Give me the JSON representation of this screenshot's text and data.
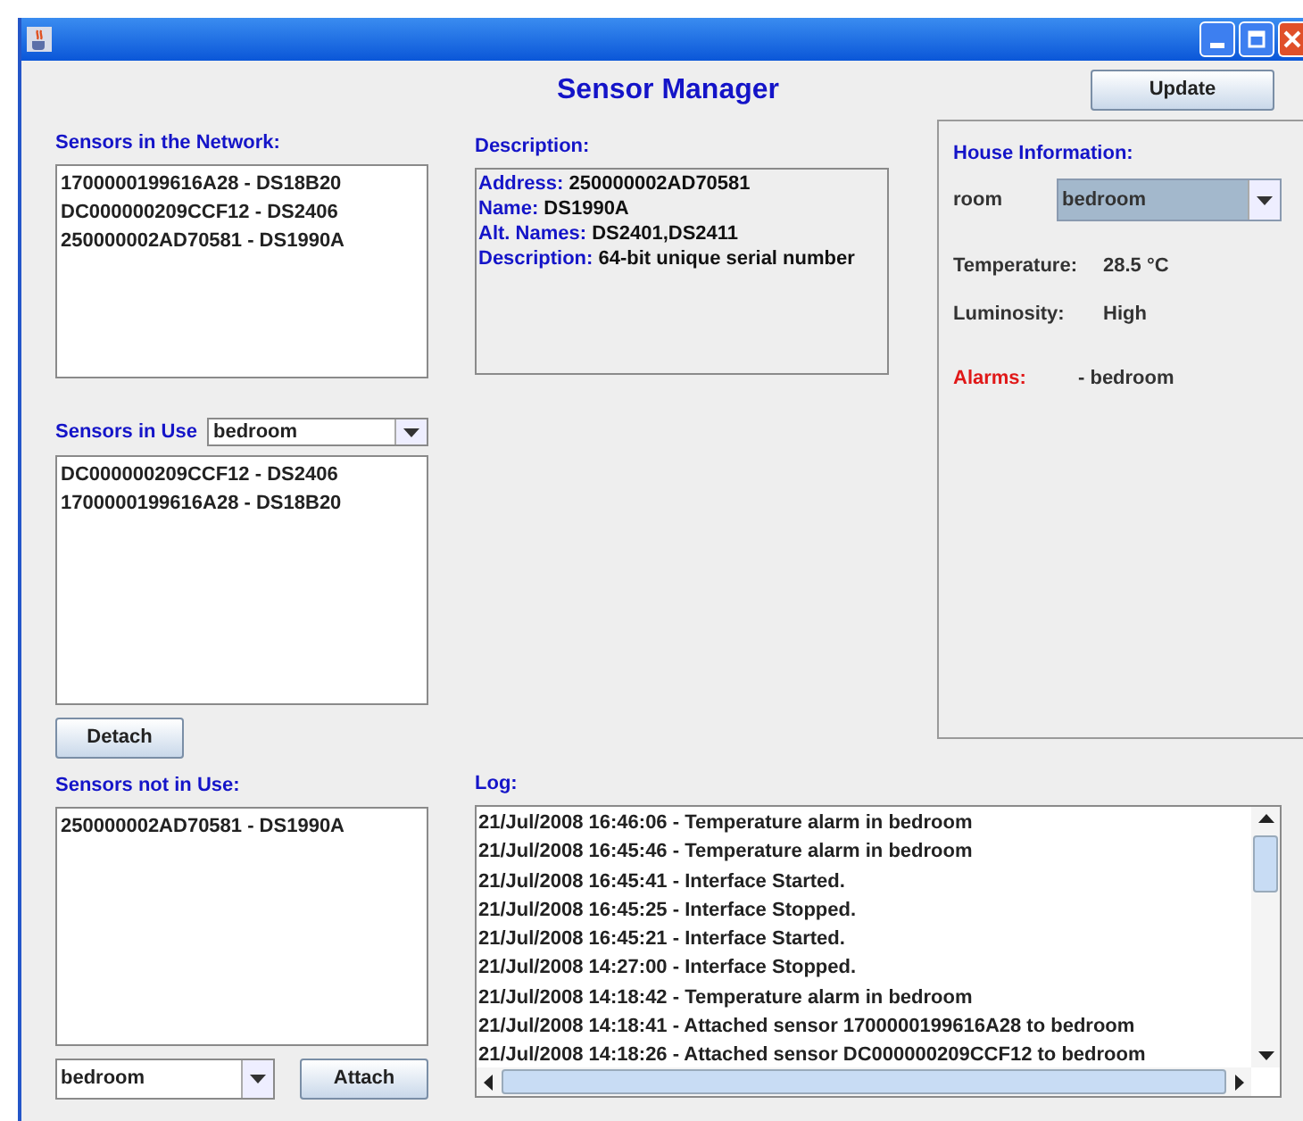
{
  "title": "Sensor Manager",
  "update_button": "Update",
  "network": {
    "label": "Sensors in the Network:",
    "items": [
      "1700000199616A28 - DS18B20",
      "DC000000209CCF12 - DS2406",
      "250000002AD70581 - DS1990A"
    ]
  },
  "in_use": {
    "label": "Sensors in Use",
    "room": "bedroom",
    "items": [
      "DC000000209CCF12 - DS2406",
      "1700000199616A28 - DS18B20"
    ],
    "detach_button": "Detach"
  },
  "not_in_use": {
    "label": "Sensors not in Use:",
    "items": [
      "250000002AD70581 - DS1990A"
    ],
    "room": "bedroom",
    "attach_button": "Attach"
  },
  "description": {
    "label": "Description:",
    "fields": [
      {
        "key": "Address:",
        "value": "250000002AD70581"
      },
      {
        "key": "Name:",
        "value": "DS1990A"
      },
      {
        "key": "Alt. Names:",
        "value": "DS2401,DS2411"
      },
      {
        "key": "Description:",
        "value": "64-bit unique serial number"
      }
    ]
  },
  "house": {
    "label": "House Information:",
    "room_label": "room",
    "room": "bedroom",
    "readings": [
      {
        "label": "Temperature:",
        "value": "28.5 °C"
      },
      {
        "label": "Luminosity:",
        "value": "High"
      }
    ],
    "alarms": {
      "label": "Alarms:",
      "value": "- bedroom"
    }
  },
  "log": {
    "label": "Log:",
    "entries": [
      "21/Jul/2008 16:46:06 - Temperature alarm in bedroom",
      "21/Jul/2008 16:45:46 - Temperature alarm in bedroom",
      "21/Jul/2008 16:45:41 - Interface Started.",
      "21/Jul/2008 16:45:25 - Interface Stopped.",
      "21/Jul/2008 16:45:21 - Interface Started.",
      "21/Jul/2008 14:27:00 - Interface Stopped.",
      "21/Jul/2008 14:18:42 - Temperature alarm in bedroom",
      "21/Jul/2008 14:18:41 - Attached sensor 1700000199616A28 to bedroom",
      "21/Jul/2008 14:18:26 - Attached sensor DC000000209CCF12 to bedroom"
    ]
  }
}
